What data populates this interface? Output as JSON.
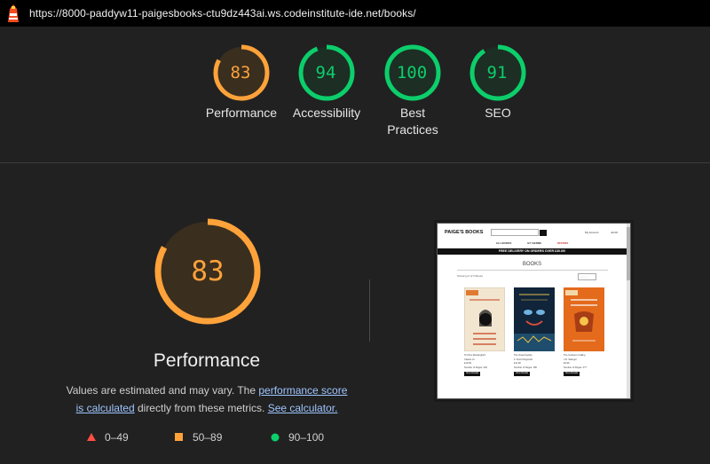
{
  "url": "https://8000-paddyw11-paigesbooks-ctu9dz443ai.ws.codeinstitute-ide.net/books/",
  "icons": {
    "logo": "lighthouse-icon",
    "legend_fail": "triangle-icon",
    "legend_average": "square-icon",
    "legend_pass": "circle-icon"
  },
  "colors": {
    "average": "#ffa23a",
    "pass": "#0cce6b",
    "fail": "#ff4e42"
  },
  "scores": [
    {
      "label": "Performance",
      "value": 83,
      "status": "average"
    },
    {
      "label": "Accessibility",
      "value": 94,
      "status": "pass"
    },
    {
      "label": "Best Practices",
      "value": 100,
      "status": "pass"
    },
    {
      "label": "SEO",
      "value": 91,
      "status": "pass"
    }
  ],
  "performance": {
    "score": 83,
    "title": "Performance",
    "desc_prefix": "Values are estimated and may vary. The ",
    "desc_link1": "performance score is calculated",
    "desc_middle": " directly from these metrics. ",
    "desc_link2": "See calculator."
  },
  "legend": [
    {
      "range": "0–49"
    },
    {
      "range": "50–89"
    },
    {
      "range": "90–100"
    }
  ],
  "screenshot": {
    "brand": "PAIGE'S BOOKS",
    "nav": [
      "ALL BOOKS",
      "BY GENRE",
      "OFFERS"
    ],
    "account": "My Account",
    "bag": "£0.00",
    "banner": "FREE DELIVERY ON ORDERS OVER £30.00!",
    "heading": "BOOKS",
    "meta": "Showing 6 of 6 Books",
    "sort": "Sort by...",
    "books": [
      {
        "title": "To Kill a Mockingbird",
        "genre": "Classic Lit",
        "price": "£10.99",
        "pages": "Number of Pages: 320",
        "btn": "View Details"
      },
      {
        "title": "The Great Gatsby",
        "genre": "F. Scott Fitzgerald",
        "price": "£11.99",
        "pages": "Number of Pages: 180",
        "btn": "View Details"
      },
      {
        "title": "The Cuckoo's Calling",
        "genre": "J.D. Salinger",
        "price": "£9.99",
        "pages": "Number of Pages: 277",
        "btn": "View Details"
      }
    ]
  }
}
